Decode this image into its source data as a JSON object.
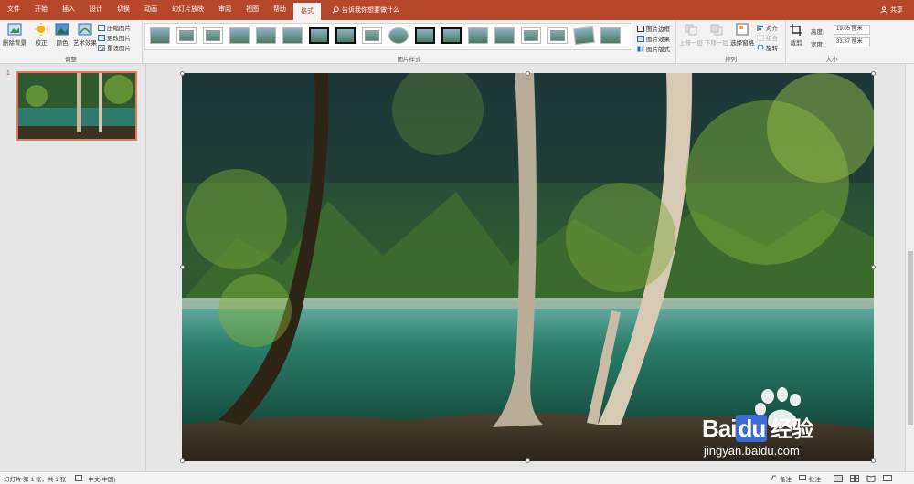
{
  "ribbon_tabs": [
    "文件",
    "开始",
    "插入",
    "设计",
    "切换",
    "动画",
    "幻灯片放映",
    "审阅",
    "视图",
    "帮助",
    "格式"
  ],
  "active_tab": "格式",
  "tell_me": "告诉我你想要做什么",
  "share": "共享",
  "groups": {
    "adjust": {
      "label": "调整",
      "remove_bg": "删除背景",
      "correct": "校正",
      "color": "颜色",
      "artistic": "艺术效果",
      "compress": "压缩图片",
      "change": "更改图片",
      "reset": "重设图片"
    },
    "styles": {
      "label": "图片样式",
      "border": "图片边框",
      "effects": "图片效果",
      "layout": "图片版式"
    },
    "arrange": {
      "label": "排列",
      "bring_forward": "上移一层",
      "send_backward": "下移一层",
      "selection_pane": "选择窗格",
      "align": "对齐",
      "group": "组合",
      "rotate": "旋转"
    },
    "size": {
      "label": "大小",
      "crop": "裁剪",
      "height_label": "高度:",
      "height_value": "19.05 厘米",
      "width_label": "宽度:",
      "width_value": "33.87 厘米"
    }
  },
  "slides_panel": {
    "slide_number": "1"
  },
  "status": {
    "slide_info": "幻灯片 第 1 张，共 1 张",
    "language": "中文(中国)",
    "notes": "备注",
    "comments": "批注"
  },
  "watermark": {
    "brand": "Bai",
    "brand2": "du",
    "cn": "经验",
    "url": "jingyan.baidu.com"
  },
  "colors": {
    "accent": "#b7472a",
    "selection": "#e8765a"
  }
}
